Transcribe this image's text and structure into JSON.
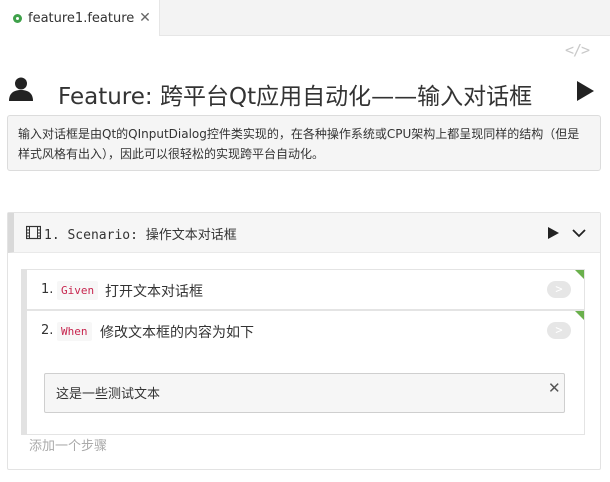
{
  "tab": {
    "label": "feature1.feature",
    "close": "✕"
  },
  "toolbar": {
    "code_view": "</>"
  },
  "feature": {
    "title": "Feature: 跨平台Qt应用自动化——输入对话框",
    "description": "输入对话框是由Qt的QInputDialog控件类实现的，在各种操作系统或CPU架构上都呈现同样的结构（但是样式风格有出入），因此可以很轻松的实现跨平台自动化。"
  },
  "scenario": {
    "title": "1. Scenario: 操作文本对话框",
    "steps": [
      {
        "number": "1.",
        "keyword": "Given",
        "text": "打开文本对话框",
        "go": ">"
      },
      {
        "number": "2.",
        "keyword": "When",
        "text": "修改文本框的内容为如下",
        "go": ">",
        "docstring": "这是一些测试文本",
        "docstring_close": "✕"
      }
    ],
    "add_step": "添加一个步骤"
  },
  "colors": {
    "accent_green": "#6ab04c",
    "keyword_red": "#c7254e"
  },
  "icons": [
    "feature-file-icon",
    "code-view-icon",
    "person-icon",
    "play-icon",
    "film-icon",
    "chevron-down-icon",
    "close-icon"
  ]
}
